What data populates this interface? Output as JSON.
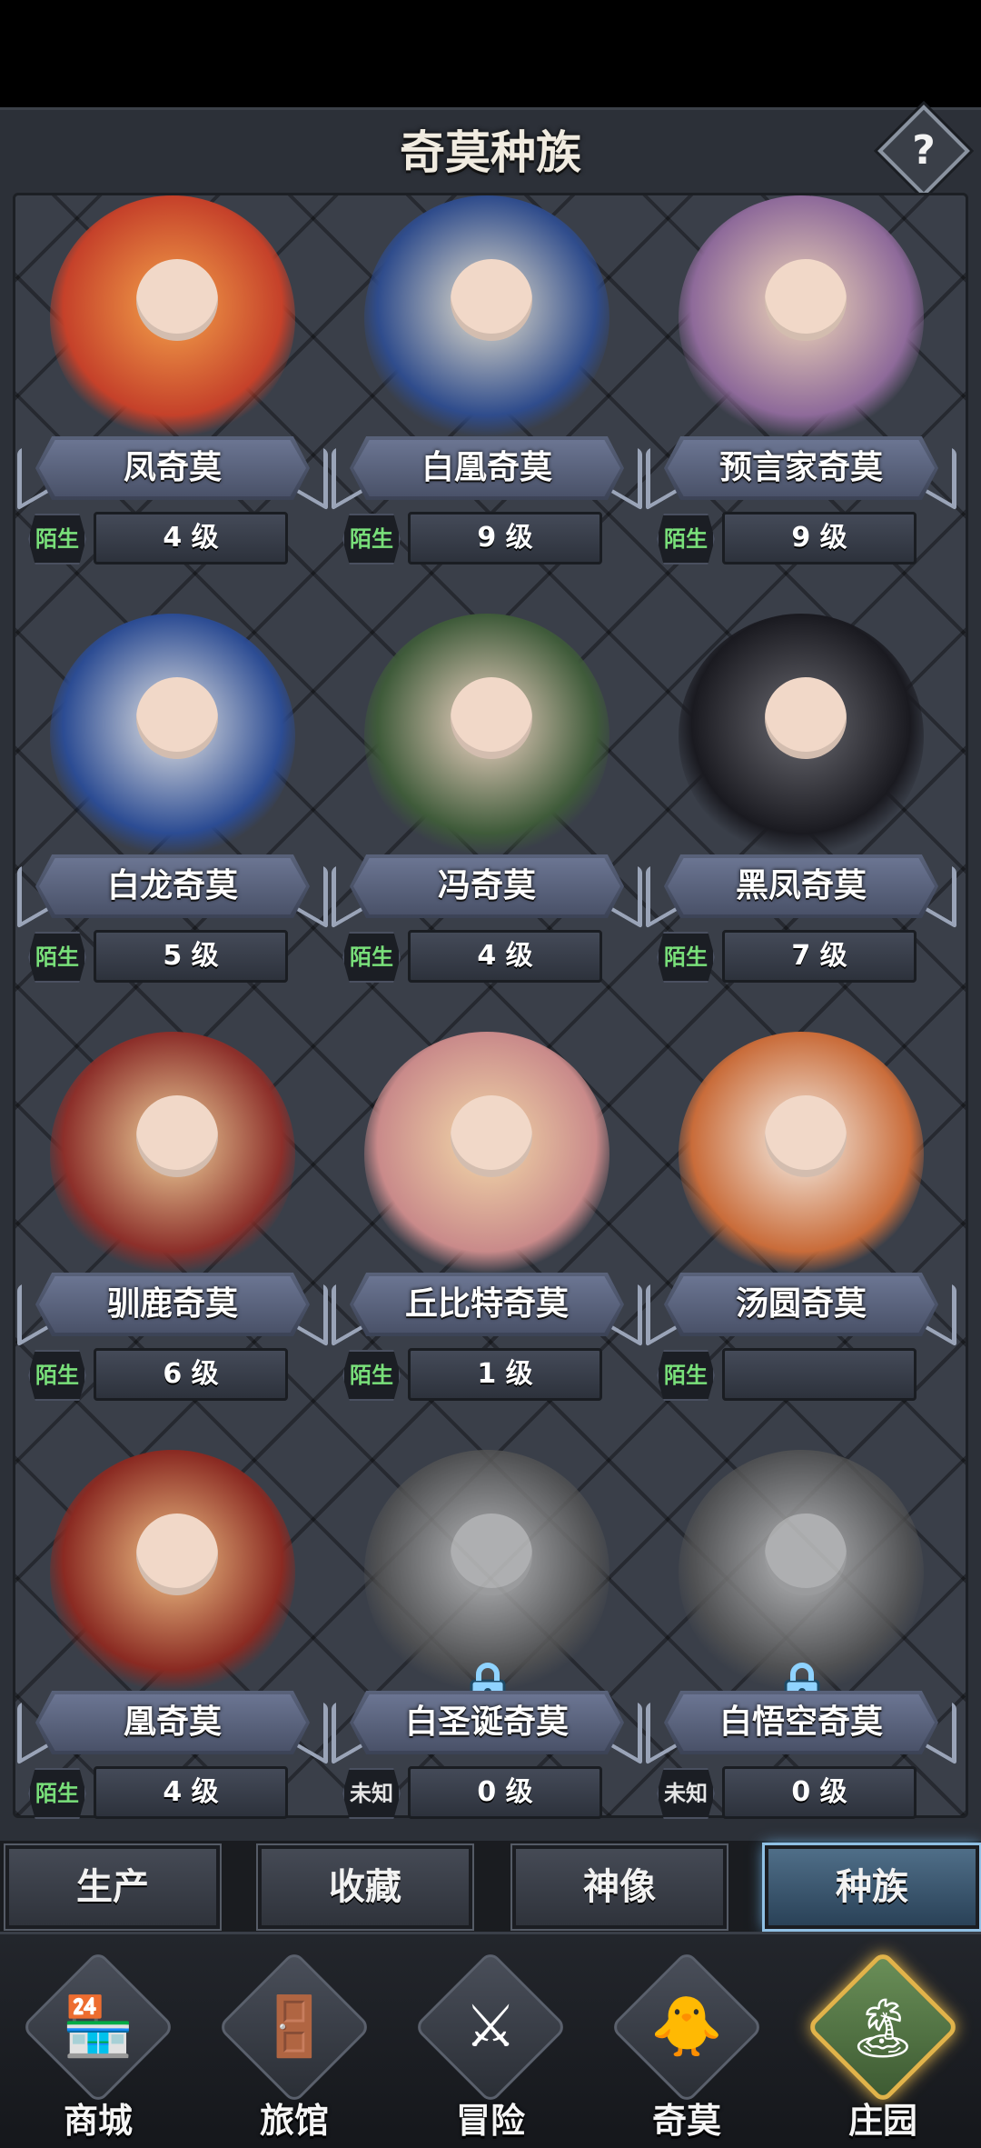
{
  "header": {
    "title": "奇莫种族",
    "help_label": "?"
  },
  "cards": [
    {
      "name": "凤奇莫",
      "status": "陌生",
      "level": "4 级",
      "c1": "#f4a24a",
      "c2": "#c5412a",
      "locked": false
    },
    {
      "name": "白凰奇莫",
      "status": "陌生",
      "level": "9 级",
      "c1": "#e8e2cf",
      "c2": "#2f4c8c",
      "locked": false
    },
    {
      "name": "预言家奇莫",
      "status": "陌生",
      "level": "9 级",
      "c1": "#f0d7b8",
      "c2": "#8e6a9a",
      "locked": false
    },
    {
      "name": "白龙奇莫",
      "status": "陌生",
      "level": "5 级",
      "c1": "#e5e5e5",
      "c2": "#2c4c93",
      "locked": false
    },
    {
      "name": "冯奇莫",
      "status": "陌生",
      "level": "4 级",
      "c1": "#f2d6c6",
      "c2": "#3f5b3a",
      "locked": false
    },
    {
      "name": "黑凤奇莫",
      "status": "陌生",
      "level": "7 级",
      "c1": "#6b6b72",
      "c2": "#1a1a20",
      "locked": false
    },
    {
      "name": "驯鹿奇莫",
      "status": "陌生",
      "level": "6 级",
      "c1": "#f0d39c",
      "c2": "#8c2f2a",
      "locked": false
    },
    {
      "name": "丘比特奇莫",
      "status": "陌生",
      "level": "1 级",
      "c1": "#f3d9a9",
      "c2": "#c98a8a",
      "locked": false
    },
    {
      "name": "汤圆奇莫",
      "status": "陌生",
      "level": "",
      "c1": "#f6efe6",
      "c2": "#c96c3a",
      "locked": false
    },
    {
      "name": "凰奇莫",
      "status": "陌生",
      "level": "4 级",
      "c1": "#f0c286",
      "c2": "#8a2a22",
      "locked": false
    },
    {
      "name": "白圣诞奇莫",
      "status": "未知",
      "level": "0 级",
      "c1": "#d8d8d8",
      "c2": "#555555",
      "locked": true
    },
    {
      "name": "白悟空奇莫",
      "status": "未知",
      "level": "0 级",
      "c1": "#d8d8d8",
      "c2": "#555555",
      "locked": true
    }
  ],
  "tabs": [
    {
      "label": "生产",
      "active": false
    },
    {
      "label": "收藏",
      "active": false
    },
    {
      "label": "神像",
      "active": false
    },
    {
      "label": "种族",
      "active": true
    }
  ],
  "nav": [
    {
      "label": "商城",
      "icon": "shop-icon",
      "glyph": "🏪",
      "active": false
    },
    {
      "label": "旅馆",
      "icon": "inn-gate-icon",
      "glyph": "🚪",
      "active": false
    },
    {
      "label": "冒险",
      "icon": "crossed-swords-icon",
      "glyph": "⚔",
      "active": false
    },
    {
      "label": "奇莫",
      "icon": "qimo-character-icon",
      "glyph": "🐥",
      "active": false
    },
    {
      "label": "庄园",
      "icon": "manor-island-icon",
      "glyph": "🏝",
      "active": true
    }
  ]
}
